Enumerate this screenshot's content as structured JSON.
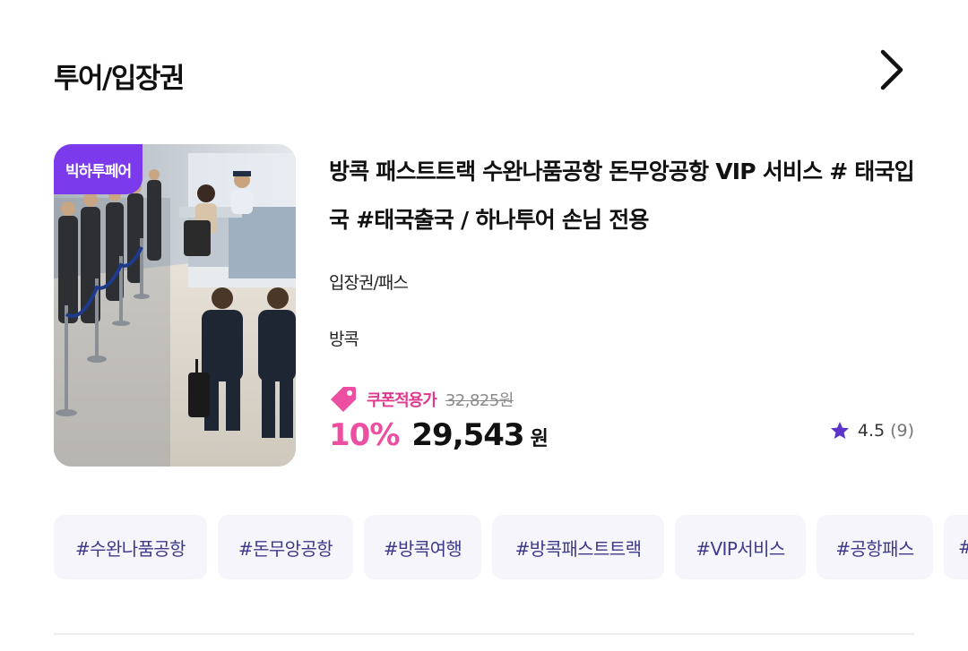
{
  "section": {
    "title": "투어/입장권",
    "more_icon": "chevron-right-icon"
  },
  "product": {
    "badge": "빅하투페어",
    "title": "방콕 패스트트랙 수완나품공항 돈무앙공항 VIP 서비스 # 태국입국 #태국출국 / 하나투어 손님 전용",
    "category": "입장권/패스",
    "location": "방콕",
    "coupon_label": "쿠폰적용가",
    "original_price": "32,825원",
    "discount": "10%",
    "price": "29,543",
    "currency": "원",
    "rating": "4.5",
    "review_count": "(9)",
    "image_desc_icon": "airport-immigration-photo"
  },
  "tags": [
    "#수완나품공항",
    "#돈무앙공항",
    "#방콕여행",
    "#방콕패스트트랙",
    "#VIP서비스",
    "#공항패스",
    "#"
  ],
  "colors": {
    "accent_pink": "#ec4fa2",
    "coupon_pink": "#e0388c",
    "badge_purple": "#7c3aed",
    "star_purple": "#5b34c9",
    "tag_bg": "#f6f5fb",
    "tag_text": "#3d3a8a"
  }
}
